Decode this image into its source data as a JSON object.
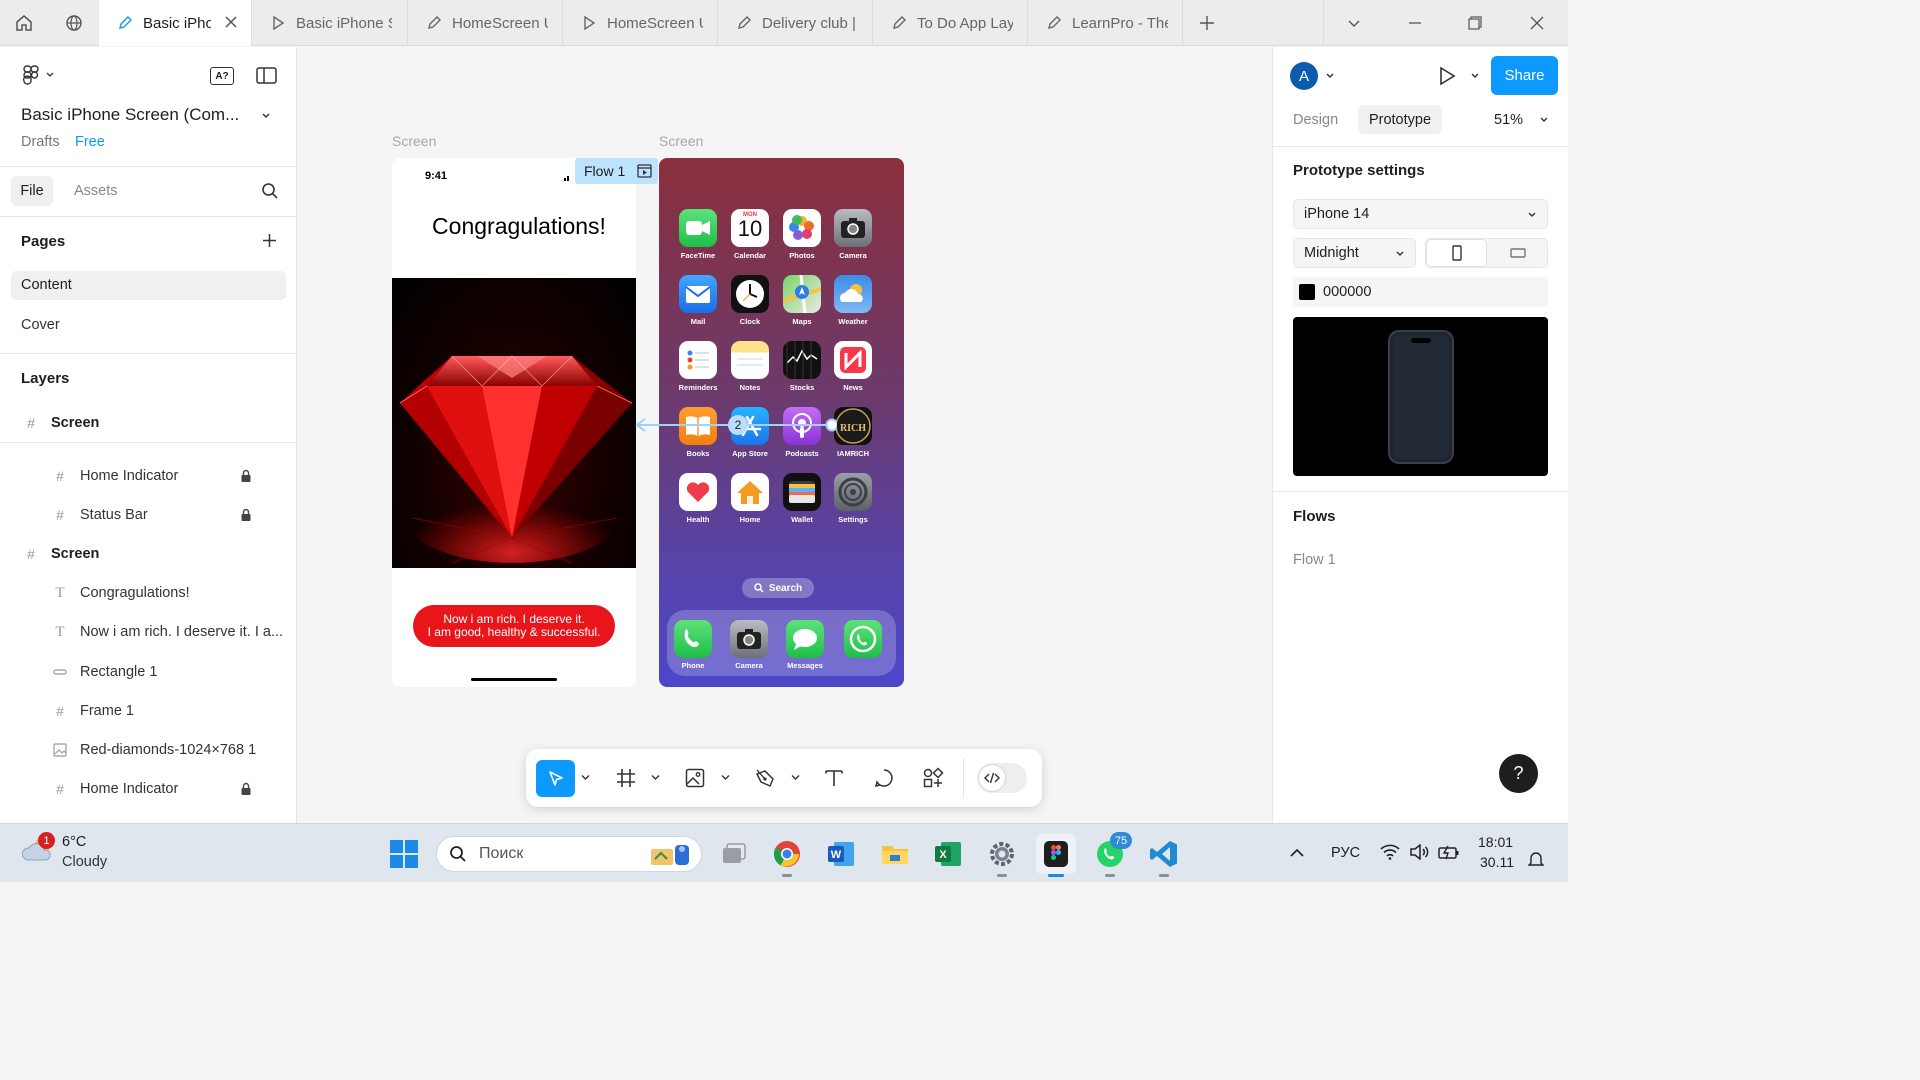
{
  "tabs": [
    {
      "label": "Basic iPhone Screen",
      "active": true
    },
    {
      "label": "Basic iPhone Screen"
    },
    {
      "label": "HomeScreen UI"
    },
    {
      "label": "HomeScreen UI"
    },
    {
      "label": "Delivery club | Mobile"
    },
    {
      "label": "To Do App Layout"
    },
    {
      "label": "LearnPro - The"
    }
  ],
  "file": {
    "title": "Basic iPhone Screen (Com...",
    "location": "Drafts",
    "plan": "Free"
  },
  "left_tabs": {
    "file": "File",
    "assets": "Assets"
  },
  "pages": {
    "heading": "Pages",
    "items": [
      "Content",
      "Cover"
    ]
  },
  "layers": {
    "heading": "Layers",
    "items": [
      {
        "name": "Screen",
        "type": "frame",
        "indent": 0,
        "locked": false
      },
      {
        "name": "Home Indicator",
        "type": "frame",
        "indent": 1,
        "locked": true
      },
      {
        "name": "Status Bar",
        "type": "frame",
        "indent": 1,
        "locked": true
      },
      {
        "name": "Screen",
        "type": "frame",
        "indent": 0,
        "locked": false
      },
      {
        "name": "Congragulations!",
        "type": "text",
        "indent": 1,
        "locked": false
      },
      {
        "name": "Now i am rich. I deserve it. I a...",
        "type": "text",
        "indent": 1,
        "locked": false
      },
      {
        "name": "Rectangle 1",
        "type": "rect",
        "indent": 1,
        "locked": false
      },
      {
        "name": "Frame 1",
        "type": "frame",
        "indent": 1,
        "locked": false
      },
      {
        "name": "Red-diamonds-1024×768 1",
        "type": "image",
        "indent": 1,
        "locked": false
      },
      {
        "name": "Home Indicator",
        "type": "frame",
        "indent": 1,
        "locked": true
      }
    ]
  },
  "canvas": {
    "frame1_label": "Screen",
    "frame2_label": "Screen",
    "flow_badge": "Flow 1",
    "status_time": "9:41",
    "headline": "Congragulations!",
    "button_text_line1": "Now i  am rich. I deserve it.",
    "button_text_line2": "I am good, healthy & successful.",
    "connection_number": "2",
    "home_apps": [
      "FaceTime",
      "Calendar",
      "Photos",
      "Camera",
      "Mail",
      "Clock",
      "Maps",
      "Weather",
      "Reminders",
      "Notes",
      "Stocks",
      "News",
      "Books",
      "App Store",
      "Podcasts",
      "IAMRICH",
      "Health",
      "Home",
      "Wallet",
      "Settings"
    ],
    "calendar_day": "MON",
    "calendar_date": "10",
    "search_label": "Search",
    "dock_apps": [
      "Phone",
      "Camera",
      "Messages"
    ]
  },
  "right": {
    "avatar_letter": "A",
    "share_label": "Share",
    "tabs": {
      "design": "Design",
      "prototype": "Prototype"
    },
    "zoom": "51%",
    "settings_title": "Prototype settings",
    "device": "iPhone 14",
    "model_color": "Midnight",
    "bg_color": "000000",
    "flows_title": "Flows",
    "flows": [
      "Flow 1"
    ],
    "help": "?"
  },
  "toolbar": {
    "icons": [
      "move-tool",
      "frame-tool",
      "image-tool",
      "pen-tool",
      "text-tool",
      "comment-tool",
      "components-tool",
      "dev-mode-toggle"
    ]
  },
  "taskbar": {
    "weather_temp": "6°C",
    "weather_desc": "Cloudy",
    "weather_badge": "1",
    "search_placeholder": "Поиск",
    "whatsapp_badge": "75",
    "lang": "РУС",
    "time": "18:01",
    "date": "30.11"
  },
  "colors": {
    "accent": "#0d99ff",
    "share": "#0d99ff",
    "button_red": "#e8161b",
    "flow_badge_bg": "#bde3ff"
  }
}
